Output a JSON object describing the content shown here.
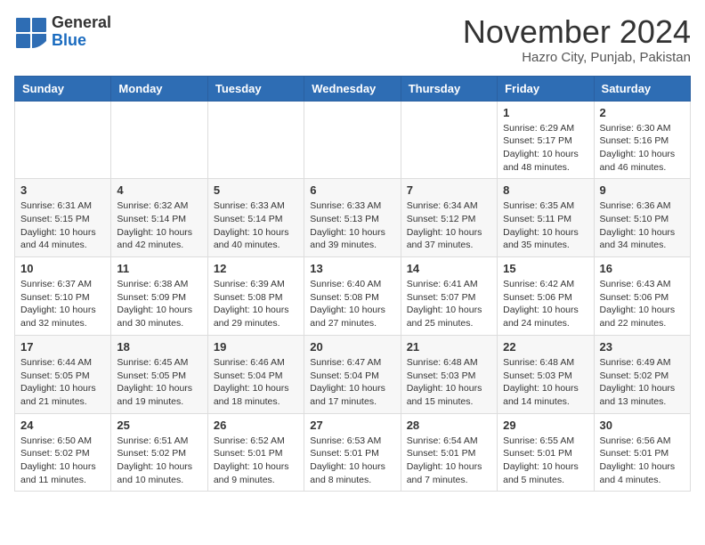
{
  "logo": {
    "general": "General",
    "blue": "Blue"
  },
  "header": {
    "month": "November 2024",
    "location": "Hazro City, Punjab, Pakistan"
  },
  "weekdays": [
    "Sunday",
    "Monday",
    "Tuesday",
    "Wednesday",
    "Thursday",
    "Friday",
    "Saturday"
  ],
  "weeks": [
    [
      {
        "day": "",
        "info": ""
      },
      {
        "day": "",
        "info": ""
      },
      {
        "day": "",
        "info": ""
      },
      {
        "day": "",
        "info": ""
      },
      {
        "day": "",
        "info": ""
      },
      {
        "day": "1",
        "info": "Sunrise: 6:29 AM\nSunset: 5:17 PM\nDaylight: 10 hours and 48 minutes."
      },
      {
        "day": "2",
        "info": "Sunrise: 6:30 AM\nSunset: 5:16 PM\nDaylight: 10 hours and 46 minutes."
      }
    ],
    [
      {
        "day": "3",
        "info": "Sunrise: 6:31 AM\nSunset: 5:15 PM\nDaylight: 10 hours and 44 minutes."
      },
      {
        "day": "4",
        "info": "Sunrise: 6:32 AM\nSunset: 5:14 PM\nDaylight: 10 hours and 42 minutes."
      },
      {
        "day": "5",
        "info": "Sunrise: 6:33 AM\nSunset: 5:14 PM\nDaylight: 10 hours and 40 minutes."
      },
      {
        "day": "6",
        "info": "Sunrise: 6:33 AM\nSunset: 5:13 PM\nDaylight: 10 hours and 39 minutes."
      },
      {
        "day": "7",
        "info": "Sunrise: 6:34 AM\nSunset: 5:12 PM\nDaylight: 10 hours and 37 minutes."
      },
      {
        "day": "8",
        "info": "Sunrise: 6:35 AM\nSunset: 5:11 PM\nDaylight: 10 hours and 35 minutes."
      },
      {
        "day": "9",
        "info": "Sunrise: 6:36 AM\nSunset: 5:10 PM\nDaylight: 10 hours and 34 minutes."
      }
    ],
    [
      {
        "day": "10",
        "info": "Sunrise: 6:37 AM\nSunset: 5:10 PM\nDaylight: 10 hours and 32 minutes."
      },
      {
        "day": "11",
        "info": "Sunrise: 6:38 AM\nSunset: 5:09 PM\nDaylight: 10 hours and 30 minutes."
      },
      {
        "day": "12",
        "info": "Sunrise: 6:39 AM\nSunset: 5:08 PM\nDaylight: 10 hours and 29 minutes."
      },
      {
        "day": "13",
        "info": "Sunrise: 6:40 AM\nSunset: 5:08 PM\nDaylight: 10 hours and 27 minutes."
      },
      {
        "day": "14",
        "info": "Sunrise: 6:41 AM\nSunset: 5:07 PM\nDaylight: 10 hours and 25 minutes."
      },
      {
        "day": "15",
        "info": "Sunrise: 6:42 AM\nSunset: 5:06 PM\nDaylight: 10 hours and 24 minutes."
      },
      {
        "day": "16",
        "info": "Sunrise: 6:43 AM\nSunset: 5:06 PM\nDaylight: 10 hours and 22 minutes."
      }
    ],
    [
      {
        "day": "17",
        "info": "Sunrise: 6:44 AM\nSunset: 5:05 PM\nDaylight: 10 hours and 21 minutes."
      },
      {
        "day": "18",
        "info": "Sunrise: 6:45 AM\nSunset: 5:05 PM\nDaylight: 10 hours and 19 minutes."
      },
      {
        "day": "19",
        "info": "Sunrise: 6:46 AM\nSunset: 5:04 PM\nDaylight: 10 hours and 18 minutes."
      },
      {
        "day": "20",
        "info": "Sunrise: 6:47 AM\nSunset: 5:04 PM\nDaylight: 10 hours and 17 minutes."
      },
      {
        "day": "21",
        "info": "Sunrise: 6:48 AM\nSunset: 5:03 PM\nDaylight: 10 hours and 15 minutes."
      },
      {
        "day": "22",
        "info": "Sunrise: 6:48 AM\nSunset: 5:03 PM\nDaylight: 10 hours and 14 minutes."
      },
      {
        "day": "23",
        "info": "Sunrise: 6:49 AM\nSunset: 5:02 PM\nDaylight: 10 hours and 13 minutes."
      }
    ],
    [
      {
        "day": "24",
        "info": "Sunrise: 6:50 AM\nSunset: 5:02 PM\nDaylight: 10 hours and 11 minutes."
      },
      {
        "day": "25",
        "info": "Sunrise: 6:51 AM\nSunset: 5:02 PM\nDaylight: 10 hours and 10 minutes."
      },
      {
        "day": "26",
        "info": "Sunrise: 6:52 AM\nSunset: 5:01 PM\nDaylight: 10 hours and 9 minutes."
      },
      {
        "day": "27",
        "info": "Sunrise: 6:53 AM\nSunset: 5:01 PM\nDaylight: 10 hours and 8 minutes."
      },
      {
        "day": "28",
        "info": "Sunrise: 6:54 AM\nSunset: 5:01 PM\nDaylight: 10 hours and 7 minutes."
      },
      {
        "day": "29",
        "info": "Sunrise: 6:55 AM\nSunset: 5:01 PM\nDaylight: 10 hours and 5 minutes."
      },
      {
        "day": "30",
        "info": "Sunrise: 6:56 AM\nSunset: 5:01 PM\nDaylight: 10 hours and 4 minutes."
      }
    ]
  ]
}
